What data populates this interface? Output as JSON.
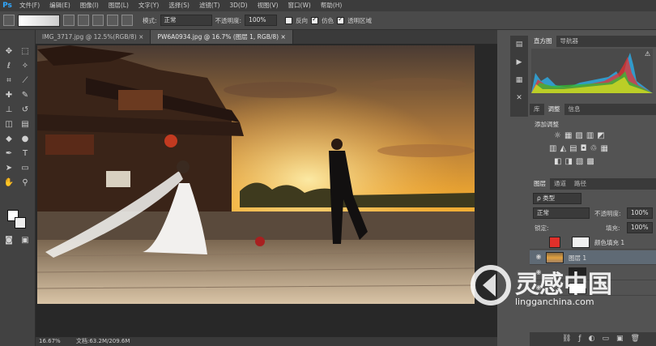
{
  "app": {
    "logo": "Ps"
  },
  "menu": [
    "文件(F)",
    "编辑(E)",
    "图像(I)",
    "图层(L)",
    "文字(Y)",
    "选择(S)",
    "滤镜(T)",
    "3D(D)",
    "视图(V)",
    "窗口(W)",
    "帮助(H)"
  ],
  "options": {
    "mode_label": "模式:",
    "mode_value": "正常",
    "opacity_label": "不透明度:",
    "opacity_value": "100%",
    "reverse_label": "反向",
    "dither_label": "仿色",
    "transparency_label": "透明区域"
  },
  "tabs": [
    {
      "label": "IMG_3717.jpg @ 12.5%(RGB/8)",
      "close": "×"
    },
    {
      "label": "PW6A0934.jpg @ 16.7% (图层 1, RGB/8)",
      "close": "×"
    }
  ],
  "status": {
    "zoom": "16.67%",
    "doc": "文档:63.2M/209.6M"
  },
  "panels": {
    "histogram_tabs": [
      "直方图",
      "导航器"
    ],
    "adjust_tabs": [
      "库",
      "调整",
      "信息"
    ],
    "adjust_title": "添加调整",
    "layers_tabs": [
      "图层",
      "通道",
      "路径"
    ],
    "kind_label": "ρ 类型",
    "blend_mode": "正常",
    "opacity_label": "不透明度:",
    "opacity_value": "100%",
    "lock_label": "锁定:",
    "fill_label": "填充:",
    "fill_value": "100%",
    "layers": [
      {
        "name": "颜色填充 1",
        "visible": true
      },
      {
        "name": "图层 1",
        "visible": true
      },
      {
        "name": "",
        "visible": true
      },
      {
        "name": "",
        "visible": true
      }
    ]
  },
  "watermark": {
    "brand": "灵感中国",
    "url": "lingganchina.com"
  },
  "colors": {
    "accent": "#31a8ff",
    "fill_swatch": "#e0302a"
  }
}
